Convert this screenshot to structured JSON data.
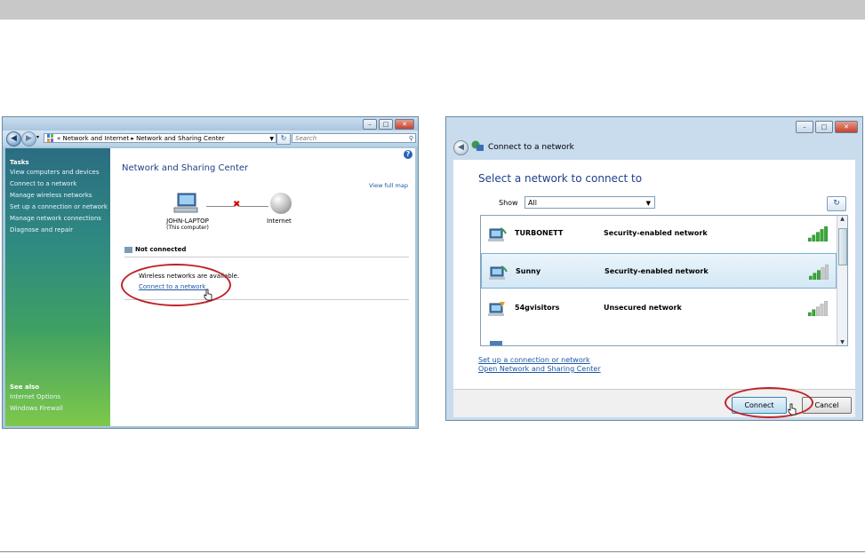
{
  "left_window": {
    "address": {
      "crumbs": "« Network and Internet ▸ Network and Sharing Center",
      "search_placeholder": "Search"
    },
    "sidebar": {
      "tasks_heading": "Tasks",
      "tasks": [
        "View computers and devices",
        "Connect to a network",
        "Manage wireless networks",
        "Set up a connection or network",
        "Manage network connections",
        "Diagnose and repair"
      ],
      "see_also_heading": "See also",
      "see_also": [
        "Internet Options",
        "Windows Firewall"
      ]
    },
    "content": {
      "title": "Network and Sharing Center",
      "view_full_map": "View full map",
      "computer_name": "JOHN-LAPTOP",
      "computer_sub": "(This computer)",
      "internet_label": "Internet",
      "status": "Not connected",
      "wireless_msg": "Wireless networks are available.",
      "connect_link": "Connect to a network"
    }
  },
  "right_window": {
    "title": "Connect to a network",
    "heading": "Select a network to connect to",
    "show_label": "Show",
    "show_value": "All",
    "networks": [
      {
        "name": "TURBONETT",
        "security": "Security-enabled network",
        "signal": 5
      },
      {
        "name": "Sunny",
        "security": "Security-enabled network",
        "signal": 3
      },
      {
        "name": "54gvisitors",
        "security": "Unsecured network",
        "signal": 2
      }
    ],
    "links": {
      "setup": "Set up a connection or network",
      "open_center": "Open Network and Sharing Center"
    },
    "buttons": {
      "connect": "Connect",
      "cancel": "Cancel"
    }
  },
  "colors": {
    "highlight_ellipse": "#c0222a",
    "link": "#1b56a6",
    "title_blue": "#1e3f8a"
  }
}
